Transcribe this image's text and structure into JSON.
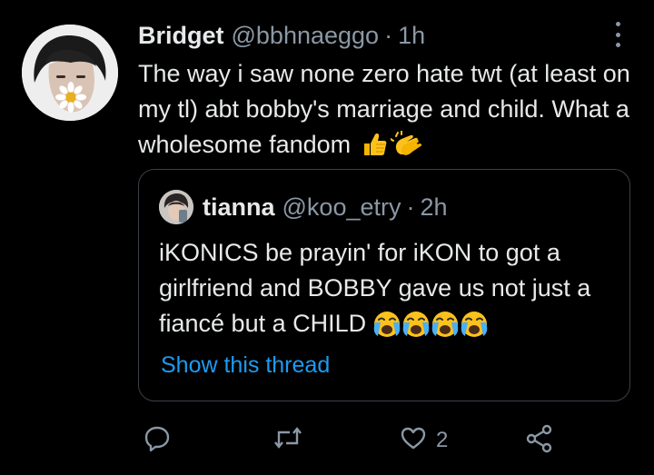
{
  "tweet": {
    "display_name": "Bridget",
    "handle": "@bbhnaeggo",
    "separator": "·",
    "time": "1h",
    "text": "The way i saw none zero hate twt (at least on my tl) abt bobby's marriage and child. What a wholesome fandom",
    "emojis": [
      "thumbs-up-icon",
      "clapping-hands-icon"
    ]
  },
  "quoted_tweet": {
    "display_name": "tianna",
    "handle": "@koo_etry",
    "separator": "·",
    "time": "2h",
    "text": "iKONICS be prayin' for iKON to got a girlfriend and BOBBY gave us not just a fiancé but a CHILD",
    "emojis": [
      "loudly-crying-face-icon",
      "loudly-crying-face-icon",
      "loudly-crying-face-icon",
      "loudly-crying-face-icon"
    ],
    "show_thread_label": "Show this thread"
  },
  "actions": {
    "reply_count": "",
    "retweet_count": "",
    "like_count": "2",
    "share_count": ""
  },
  "colors": {
    "background": "#000000",
    "text": "#e7e9ea",
    "secondary": "#8b98a5",
    "accent": "#1d9bf0",
    "border": "#3b4148"
  }
}
